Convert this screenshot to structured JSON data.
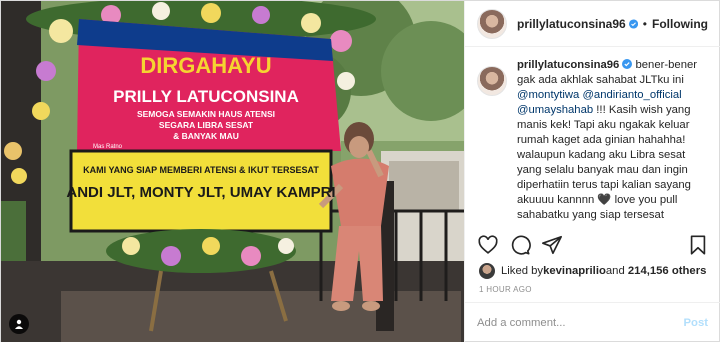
{
  "post": {
    "username": "prillylatuconsina96",
    "follow_label": "Following",
    "separator": "•",
    "photo": {
      "banner_title": "DIRGAHAYU",
      "banner_name": "PRILLY LATUCONSINA",
      "banner_line1": "SEMOGA SEMAKIN HAUS ATENSI",
      "banner_line2": "SEGARA LIBRA SESAT",
      "banner_line3": "& BANYAK MAU",
      "banner_small": "Mas Ratno",
      "board_line1": "KAMI YANG SIAP MEMBERI ATENSI & IKUT TERSESAT",
      "board_line2": "ANDI JLT, MONTY JLT, UMAY KAMPRI"
    },
    "caption": {
      "username": "prillylatuconsina96",
      "part1": " bener-bener gak ada akhlak sahabat JLTku ini ",
      "mention1": "@montytiwa",
      "mention2": "@andirianto_official",
      "mention3": "@umayshahab",
      "part2": " !!! Kasih wish yang manis kek! Tapi aku ngakak keluar rumah kaget ada ginian hahahha! walaupun kadang aku Libra sesat yang selalu banyak mau dan ingin diperhatiin terus tapi kalian sayang akuuuu kannnn 🖤 love you pull sahabatku yang siap tersesat"
    },
    "likes": {
      "prefix": "Liked by ",
      "user": "kevinaprilio",
      "middle": " and ",
      "count": "214,156 others"
    },
    "timestamp": "1 HOUR AGO",
    "comment": {
      "placeholder": "Add a comment...",
      "post_label": "Post"
    },
    "icons": [
      "verified-icon",
      "heart-icon",
      "comment-icon",
      "share-icon",
      "bookmark-icon",
      "user-tag-icon"
    ],
    "colors": {
      "link": "#00376b",
      "post_disabled": "#b2dffc",
      "verified": "#3897f0"
    }
  }
}
